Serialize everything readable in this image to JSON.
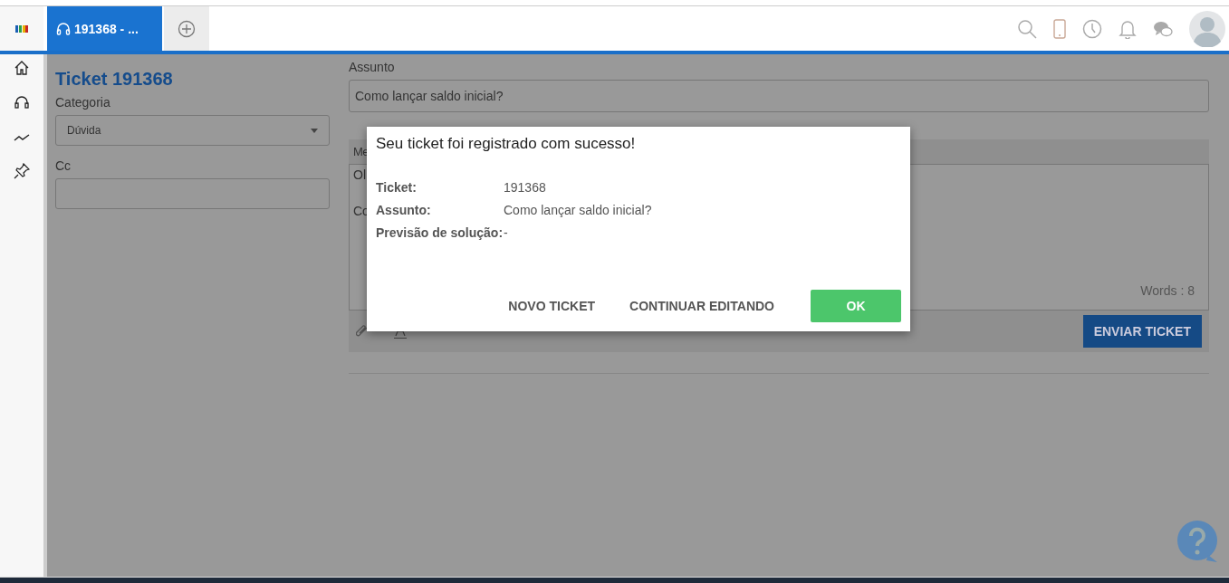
{
  "tabs": [
    {
      "label": "191368 - ...",
      "selected": true
    }
  ],
  "ticket": {
    "title": "Ticket 191368",
    "category_label": "Categoria",
    "category_value": "Dúvida",
    "cc_label": "Cc",
    "subject_label": "Assunto",
    "subject_value": "Como lançar saldo inicial?",
    "message_label": "Me",
    "message_lines": [
      "Ol",
      "Co"
    ],
    "word_count": "Words : 8",
    "send_button": "ENVIAR TICKET"
  },
  "dialog": {
    "title": "Seu ticket foi registrado com sucesso!",
    "fields": [
      {
        "label": "Ticket:",
        "value": "191368"
      },
      {
        "label": "Assunto:",
        "value": "Como lançar saldo inicial?"
      },
      {
        "label": "Previsão de solução:",
        "value": "-"
      }
    ],
    "buttons": [
      {
        "label": "NOVO TICKET",
        "kind": "text"
      },
      {
        "label": "CONTINUAR EDITANDO",
        "kind": "text"
      },
      {
        "label": "OK",
        "kind": "primary"
      }
    ]
  }
}
